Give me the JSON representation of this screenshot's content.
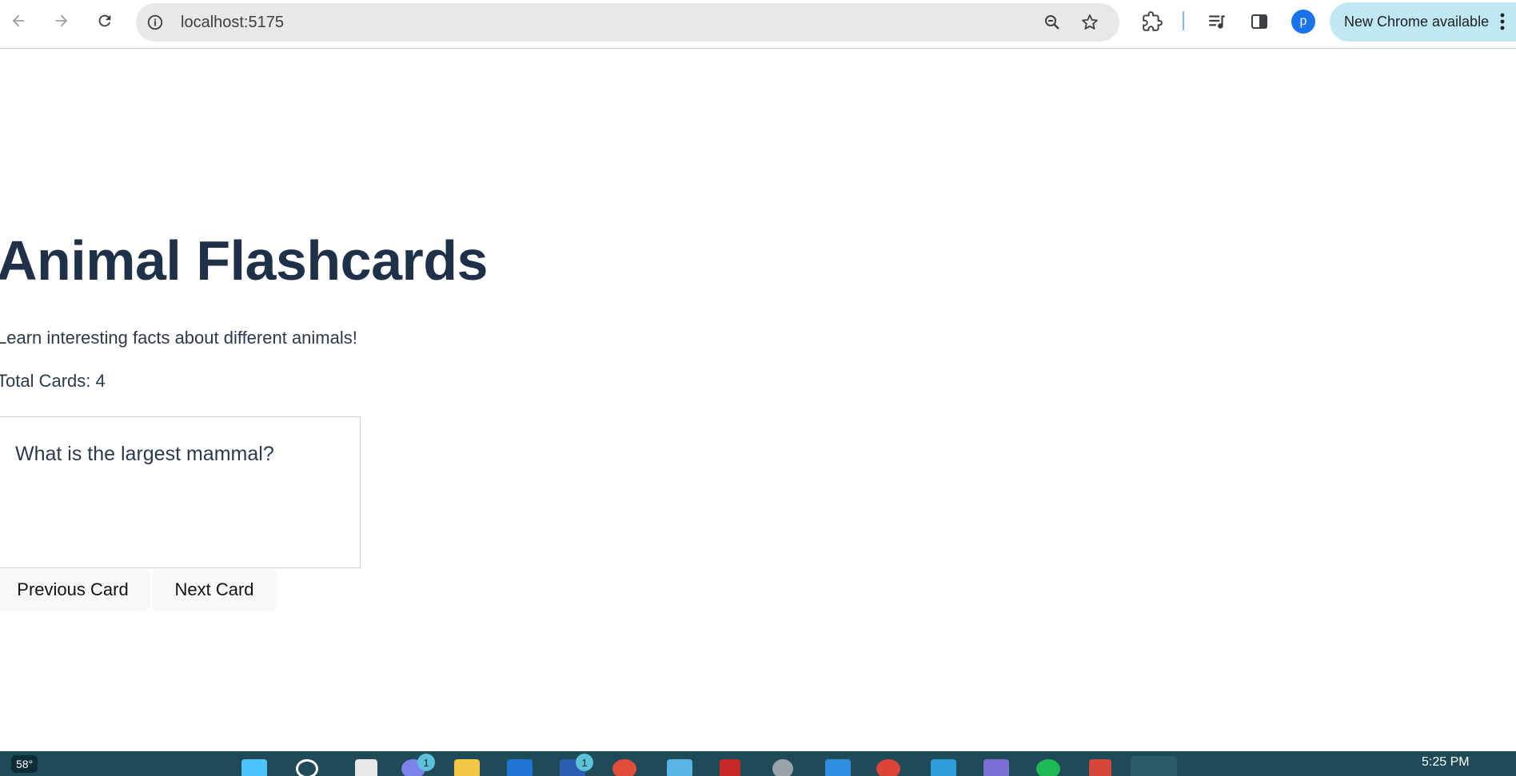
{
  "browser": {
    "url": "localhost:5175",
    "update_chip_label": "New Chrome available",
    "profile_initial": "p"
  },
  "page": {
    "title": "Animal Flashcards",
    "subtitle": "Learn interesting facts about different animals!",
    "total_cards_text": "Total Cards: 4",
    "card": {
      "question": "What is the largest mammal?"
    },
    "buttons": {
      "previous": "Previous Card",
      "next": "Next Card"
    }
  },
  "taskbar": {
    "weather_temp": "58°",
    "badge_a": "1",
    "badge_b": "1",
    "clock": "5:25 PM"
  },
  "colors": {
    "title": "#1f3148",
    "text": "#2b3a4c",
    "taskbar": "#1f4a57",
    "update_chip": "#bfe8f3",
    "avatar": "#1a73e8"
  }
}
